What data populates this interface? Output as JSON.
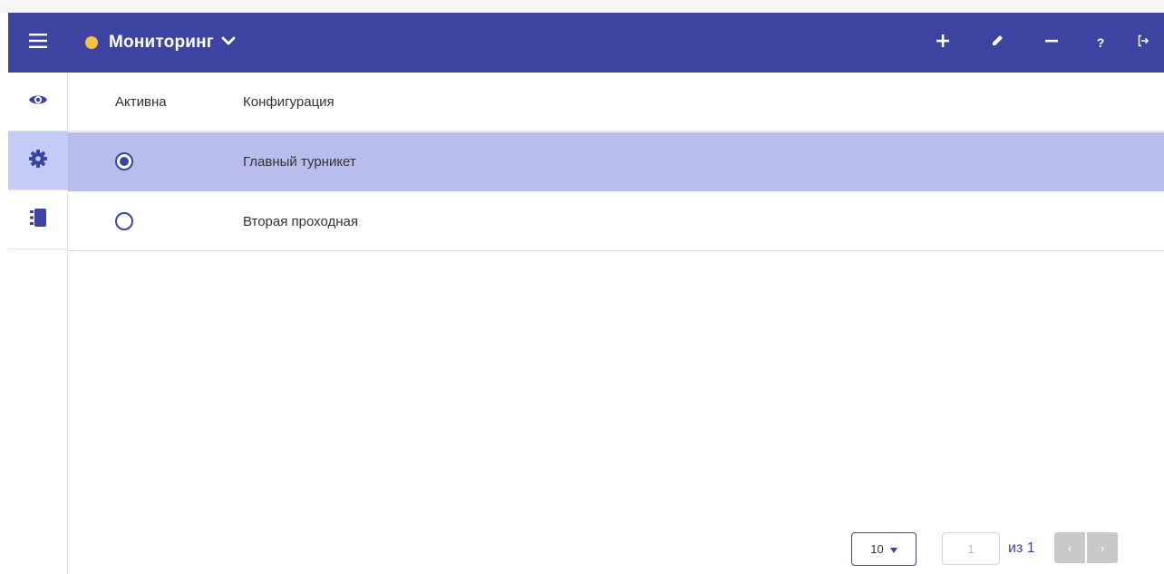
{
  "header": {
    "title": "Мониторинг",
    "status_color": "#f7c243",
    "accent_color": "#3c43a0",
    "icons": [
      "menu-icon",
      "chevron-down-icon",
      "plus-icon",
      "pencil-icon",
      "minus-icon",
      "help-icon",
      "logout-icon"
    ],
    "help_label": "?"
  },
  "sidebar": {
    "items": [
      {
        "icon": "eye-icon",
        "active": false
      },
      {
        "icon": "gear-icon",
        "active": true
      },
      {
        "icon": "address-book-icon",
        "active": false
      }
    ]
  },
  "table": {
    "columns": [
      "Активна",
      "Конфигурация"
    ],
    "rows": [
      {
        "active": true,
        "name": "Главный турникет"
      },
      {
        "active": false,
        "name": "Вторая проходная"
      }
    ]
  },
  "pagination": {
    "page_size": "10",
    "current_page": "1",
    "of_label": "из 1",
    "prev_label": "‹",
    "next_label": "›"
  }
}
